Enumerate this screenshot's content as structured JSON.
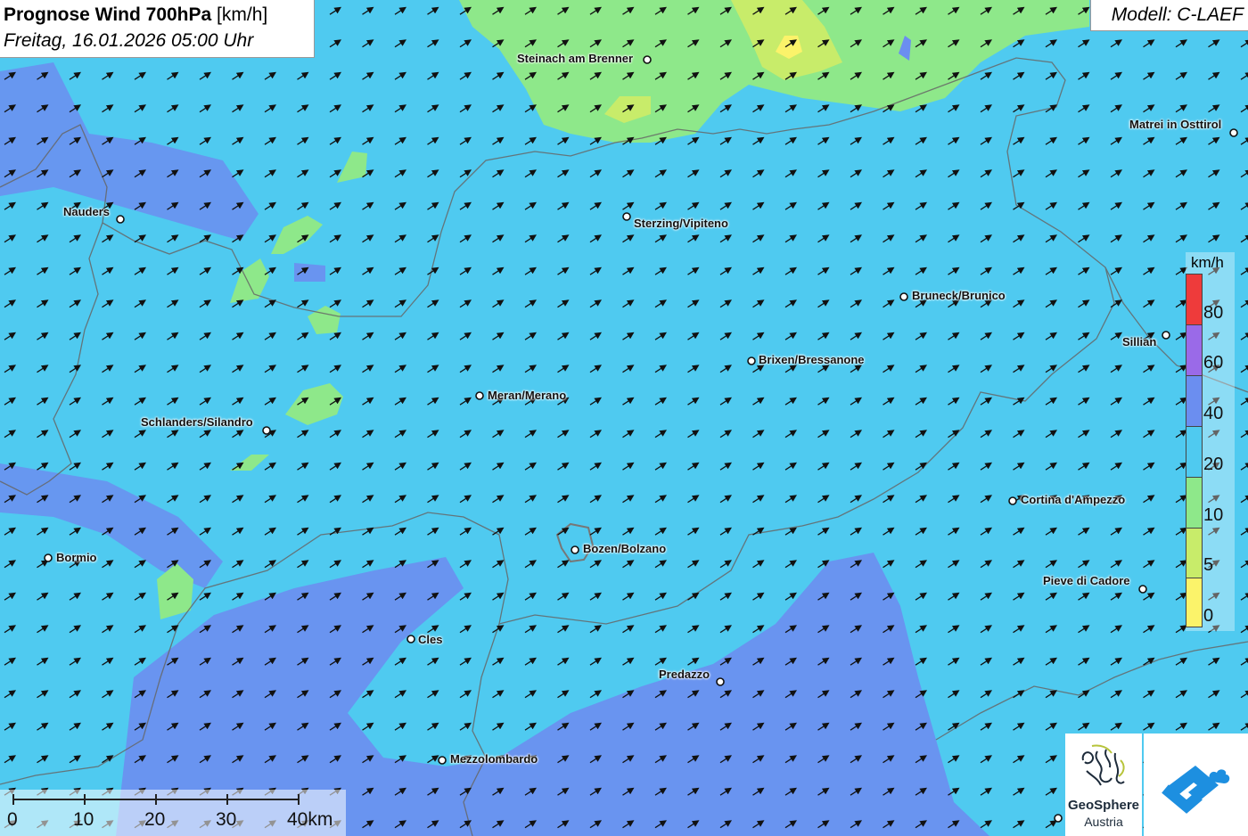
{
  "header": {
    "title_bold": "Prognose Wind 700hPa",
    "title_unit": "[km/h]",
    "subtitle": "Freitag, 16.01.2026 05:00 Uhr",
    "model": "Modell: C-LAEF"
  },
  "cities": [
    {
      "name": "Steinach am Brenner",
      "key": "steinach"
    },
    {
      "name": "Matrei in Osttirol",
      "key": "matrei"
    },
    {
      "name": "Nauders",
      "key": "nauders"
    },
    {
      "name": "Sterzing/Vipiteno",
      "key": "sterzing"
    },
    {
      "name": "Bruneck/Brunico",
      "key": "bruneck"
    },
    {
      "name": "Sillian",
      "key": "sillian"
    },
    {
      "name": "Brixen/Bressanone",
      "key": "brixen"
    },
    {
      "name": "Meran/Merano",
      "key": "meran"
    },
    {
      "name": "Schlanders/Silandro",
      "key": "schlanders"
    },
    {
      "name": "Cortina d'Ampezzo",
      "key": "cortina"
    },
    {
      "name": "Bormio",
      "key": "bormio"
    },
    {
      "name": "Bozen/Bolzano",
      "key": "bozen"
    },
    {
      "name": "Pieve di Cadore",
      "key": "pieve"
    },
    {
      "name": "Cles",
      "key": "cles"
    },
    {
      "name": "Predazzo",
      "key": "predazzo"
    },
    {
      "name": "Mezzolombardo",
      "key": "mezzolombardo"
    }
  ],
  "legend": {
    "unit": "km/h",
    "ticks": [
      "80",
      "60",
      "40",
      "20",
      "10",
      "5",
      "0"
    ],
    "colors": {
      "above_80": "#ee3b3b",
      "60_80": "#9a6ae8",
      "40_60": "#6b8ef0",
      "20_40": "#4fcaf0",
      "10_20": "#8ee88a",
      "5_10": "#c8ec6a",
      "0_5": "#fbf36a"
    }
  },
  "scale": {
    "labels": [
      "0",
      "10",
      "20",
      "30",
      "40km"
    ]
  },
  "wind": {
    "arrow_direction": "north-east",
    "dominant_speed_class": "20-40 km/h"
  },
  "logos": {
    "geosphere_line1": "GeoSphere",
    "geosphere_line2": "Austria"
  }
}
